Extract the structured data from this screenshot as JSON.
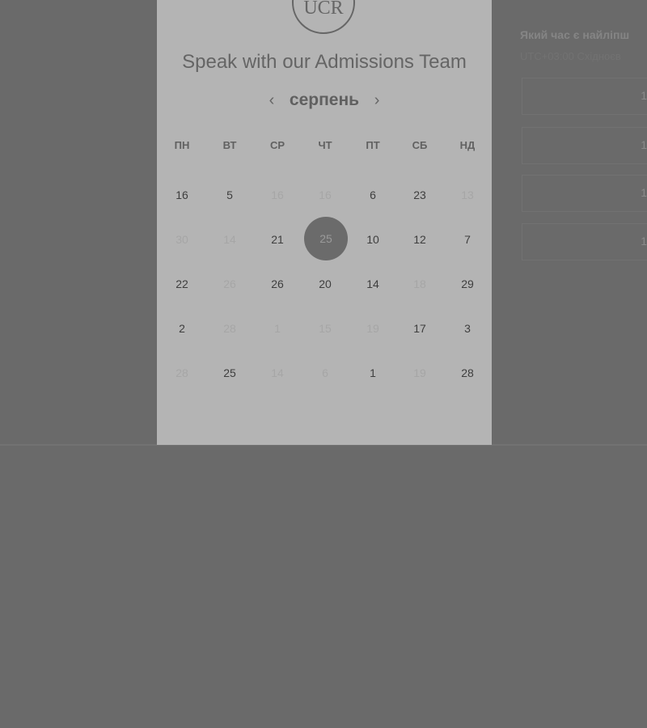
{
  "logo": {
    "text": "UCR"
  },
  "calendar": {
    "title": "Speak with our Admissions Team",
    "month": "серпень",
    "prev_icon": "‹",
    "next_icon": "›",
    "weekdays": [
      "ПН",
      "ВТ",
      "СР",
      "ЧТ",
      "ПТ",
      "СБ",
      "НД"
    ],
    "weeks": [
      [
        {
          "d": "16",
          "a": true
        },
        {
          "d": "5",
          "a": true
        },
        {
          "d": "16",
          "a": false
        },
        {
          "d": "16",
          "a": false
        },
        {
          "d": "6",
          "a": true
        },
        {
          "d": "23",
          "a": true
        },
        {
          "d": "13",
          "a": false
        }
      ],
      [
        {
          "d": "30",
          "a": false
        },
        {
          "d": "14",
          "a": false
        },
        {
          "d": "21",
          "a": true
        },
        {
          "d": "25",
          "a": true,
          "s": true
        },
        {
          "d": "10",
          "a": true
        },
        {
          "d": "12",
          "a": true
        },
        {
          "d": "7",
          "a": true
        }
      ],
      [
        {
          "d": "22",
          "a": true
        },
        {
          "d": "26",
          "a": false
        },
        {
          "d": "26",
          "a": true
        },
        {
          "d": "20",
          "a": true
        },
        {
          "d": "14",
          "a": true
        },
        {
          "d": "18",
          "a": false
        },
        {
          "d": "29",
          "a": true
        }
      ],
      [
        {
          "d": "2",
          "a": true
        },
        {
          "d": "28",
          "a": false
        },
        {
          "d": "1",
          "a": false
        },
        {
          "d": "15",
          "a": false
        },
        {
          "d": "19",
          "a": false
        },
        {
          "d": "17",
          "a": true
        },
        {
          "d": "3",
          "a": true
        }
      ],
      [
        {
          "d": "28",
          "a": false
        },
        {
          "d": "25",
          "a": true
        },
        {
          "d": "14",
          "a": false
        },
        {
          "d": "6",
          "a": false
        },
        {
          "d": "1",
          "a": true
        },
        {
          "d": "19",
          "a": false
        },
        {
          "d": "28",
          "a": true
        }
      ]
    ]
  },
  "right_panel": {
    "title": "Який час є найліпш",
    "subtitle": "UTC+03:00 Східноєв",
    "slots": [
      "1",
      "1",
      "1",
      "1"
    ]
  },
  "colors": {
    "backdrop": "#6a6a6a",
    "card": "#b4b4b4",
    "selected_day": "#6b6b6b"
  }
}
